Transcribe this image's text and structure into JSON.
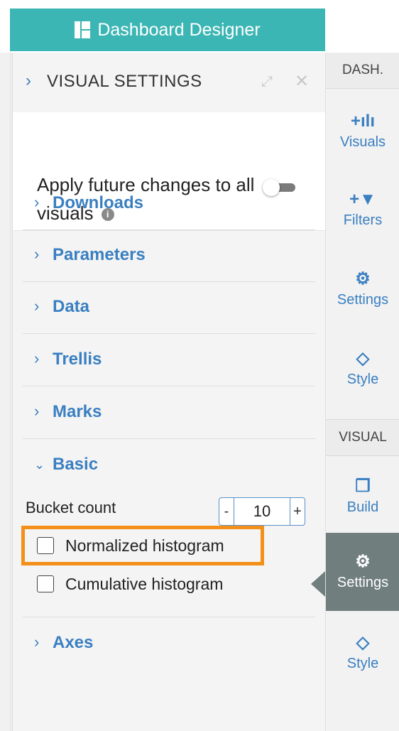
{
  "header": {
    "title": "Dashboard Designer"
  },
  "panel": {
    "title": "VISUAL SETTINGS",
    "apply_text": "Apply future changes to all visuals",
    "toggle_on": false,
    "sections": [
      {
        "label": "Downloads",
        "expanded": false
      },
      {
        "label": "Parameters",
        "expanded": false
      },
      {
        "label": "Data",
        "expanded": false
      },
      {
        "label": "Trellis",
        "expanded": false
      },
      {
        "label": "Marks",
        "expanded": false
      },
      {
        "label": "Basic",
        "expanded": true
      },
      {
        "label": "Axes",
        "expanded": false
      }
    ],
    "basic": {
      "bucket_label": "Bucket count",
      "bucket_value": "10",
      "minus": "-",
      "plus": "+",
      "normalized_label": "Normalized histogram",
      "cumulative_label": "Cumulative histogram"
    }
  },
  "rightnav": {
    "dash_group": "DASH.",
    "visual_group": "VISUAL",
    "items": [
      {
        "label": "Visuals",
        "icon": "add-chart-icon"
      },
      {
        "label": "Filters",
        "icon": "add-filter-icon"
      },
      {
        "label": "Settings",
        "icon": "gears-icon"
      },
      {
        "label": "Style",
        "icon": "diamond-icon"
      },
      {
        "label": "Build",
        "icon": "cubes-icon"
      },
      {
        "label": "Settings",
        "icon": "gears-icon"
      },
      {
        "label": "Style",
        "icon": "diamond-icon"
      }
    ]
  },
  "colors": {
    "accent": "#3a7fc1",
    "header": "#3bb6b4",
    "highlight": "#f39019",
    "active_nav": "#717e7e"
  }
}
